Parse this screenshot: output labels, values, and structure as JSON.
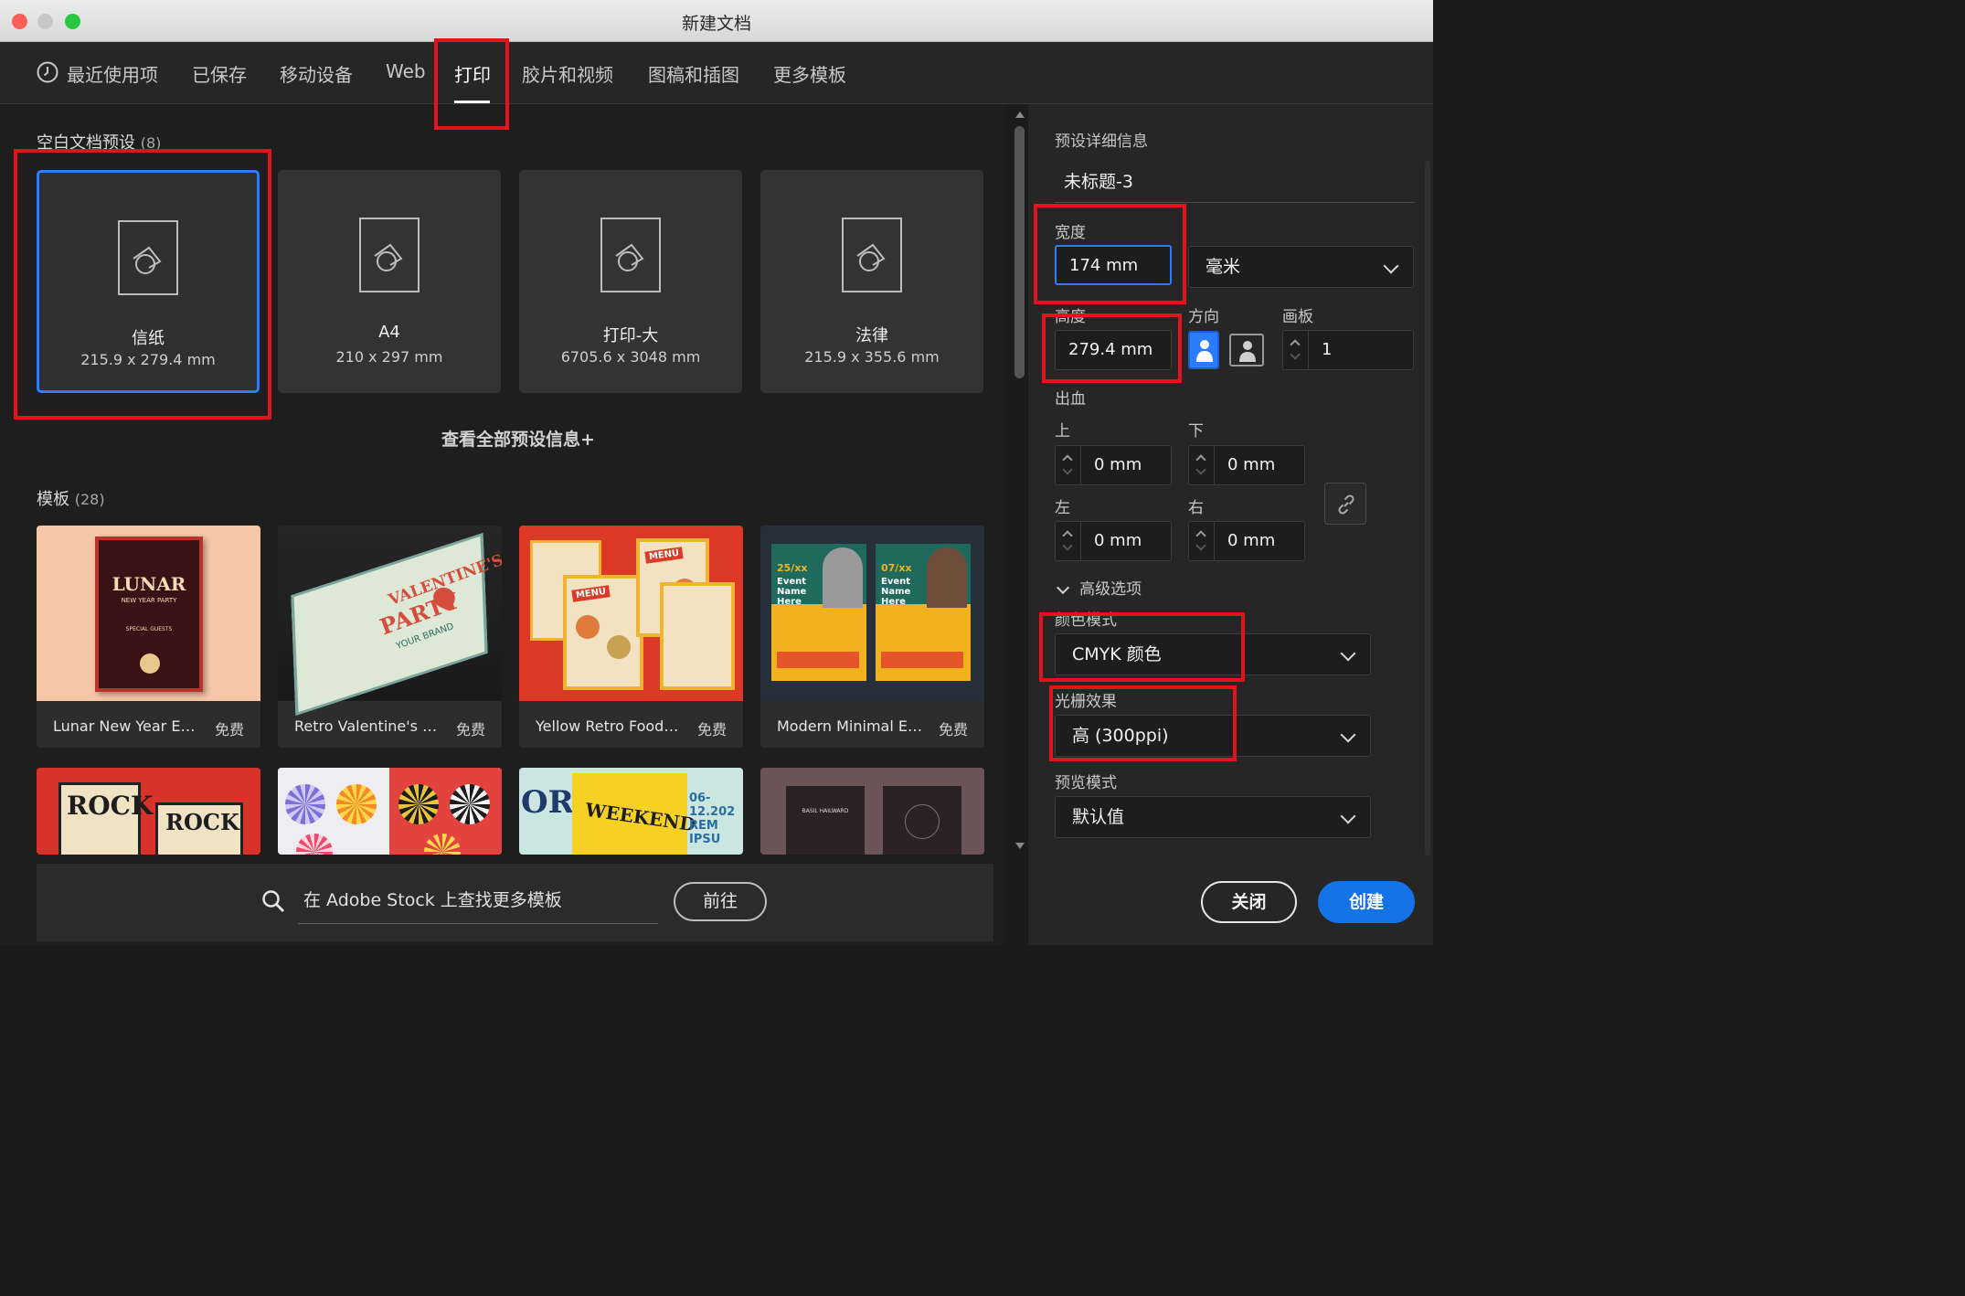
{
  "window": {
    "title": "新建文档"
  },
  "tabs": [
    {
      "label": "最近使用项"
    },
    {
      "label": "已保存"
    },
    {
      "label": "移动设备"
    },
    {
      "label": "Web"
    },
    {
      "label": "打印"
    },
    {
      "label": "胶片和视频"
    },
    {
      "label": "图稿和插图"
    },
    {
      "label": "更多模板"
    }
  ],
  "active_tab": "打印",
  "presets": {
    "title": "空白文档预设",
    "count": "(8)",
    "items": [
      {
        "name": "信纸",
        "size": "215.9 x 279.4 mm"
      },
      {
        "name": "A4",
        "size": "210 x 297 mm"
      },
      {
        "name": "打印-大",
        "size": "6705.6 x 3048 mm"
      },
      {
        "name": "法律",
        "size": "215.9 x 355.6 mm"
      }
    ],
    "view_all": "查看全部预设信息+"
  },
  "templates": {
    "title": "模板",
    "count": "(28)",
    "items": [
      {
        "name": "Lunar New Year Even...",
        "price": "免费",
        "thumb_text_1": "LUNAR",
        "thumb_text_2": "NEW YEAR PARTY",
        "thumb_text_3": "SPECIAL GUESTS"
      },
      {
        "name": "Retro Valentine's Day...",
        "price": "免费",
        "thumb_text_1": "VALENTINE'S",
        "thumb_text_2": "PARTY",
        "thumb_text_3": "YOUR BRAND"
      },
      {
        "name": "Yellow Retro Food M...",
        "price": "免费",
        "thumb_text_1": "MENU",
        "thumb_text_2": "MENU"
      },
      {
        "name": "Modern Minimal Eve...",
        "price": "免费",
        "thumb_text_1": "25/xx",
        "thumb_text_2": "Event Name Here",
        "thumb_text_3": "07/xx",
        "thumb_text_4": "Event Name Here"
      }
    ],
    "row2": [
      {
        "thumb_text_1": "ROCK",
        "thumb_text_2": "ROCK"
      },
      {},
      {
        "thumb_text_1": "ORE",
        "thumb_text_2": "WEEKEND",
        "thumb_text_3": "06-12.202",
        "thumb_text_4": "REM IPSU"
      },
      {
        "thumb_text_1": "BASIL HAILWARD"
      }
    ]
  },
  "stock": {
    "placeholder": "在 Adobe Stock 上查找更多模板",
    "button": "前往"
  },
  "details": {
    "section_title": "预设详细信息",
    "doc_name": "未标题-3",
    "width_label": "宽度",
    "width_value": "174 mm",
    "unit": "毫米",
    "height_label": "高度",
    "height_value": "279.4 mm",
    "orientation_label": "方向",
    "artboard_label": "画板",
    "artboard_value": "1",
    "bleed_label": "出血",
    "bleed": {
      "top_label": "上",
      "top": "0 mm",
      "bottom_label": "下",
      "bottom": "0 mm",
      "left_label": "左",
      "left": "0 mm",
      "right_label": "右",
      "right": "0 mm"
    },
    "advanced_label": "高级选项",
    "color_mode_label": "颜色模式",
    "color_mode": "CMYK 颜色",
    "raster_label": "光栅效果",
    "raster": "高 (300ppi)",
    "preview_label": "预览模式",
    "preview": "默认值"
  },
  "buttons": {
    "close": "关闭",
    "create": "创建"
  },
  "colors": {
    "accent": "#2b7cff",
    "highlight": "#e1131c",
    "create": "#1473e6"
  }
}
